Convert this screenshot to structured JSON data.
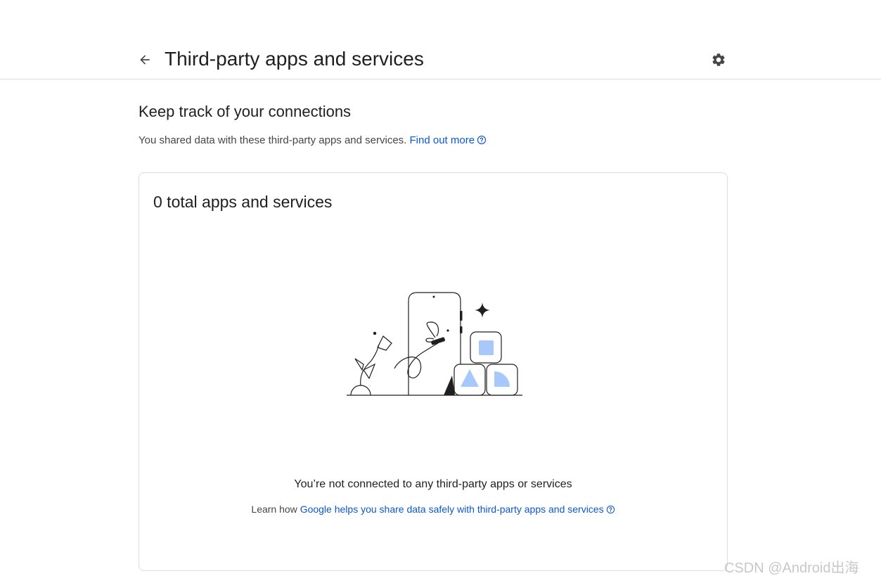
{
  "header": {
    "title": "Third-party apps and services",
    "back_icon": "arrow-back-icon",
    "settings_icon": "gear-icon"
  },
  "section": {
    "title": "Keep track of your connections",
    "intro_text": "You shared data with these third-party apps and services.",
    "find_out_more": "Find out more"
  },
  "card": {
    "title": "0 total apps and services",
    "empty_title": "You’re not connected to any third-party apps or services",
    "learn_prefix": "Learn how ",
    "learn_link": "Google helps you share data safely with third-party apps and services"
  },
  "watermark": "CSDN @Android出海",
  "colors": {
    "link": "#0b57d0",
    "divider": "#dadce0",
    "illustration_accent": "#a8c7fa"
  }
}
